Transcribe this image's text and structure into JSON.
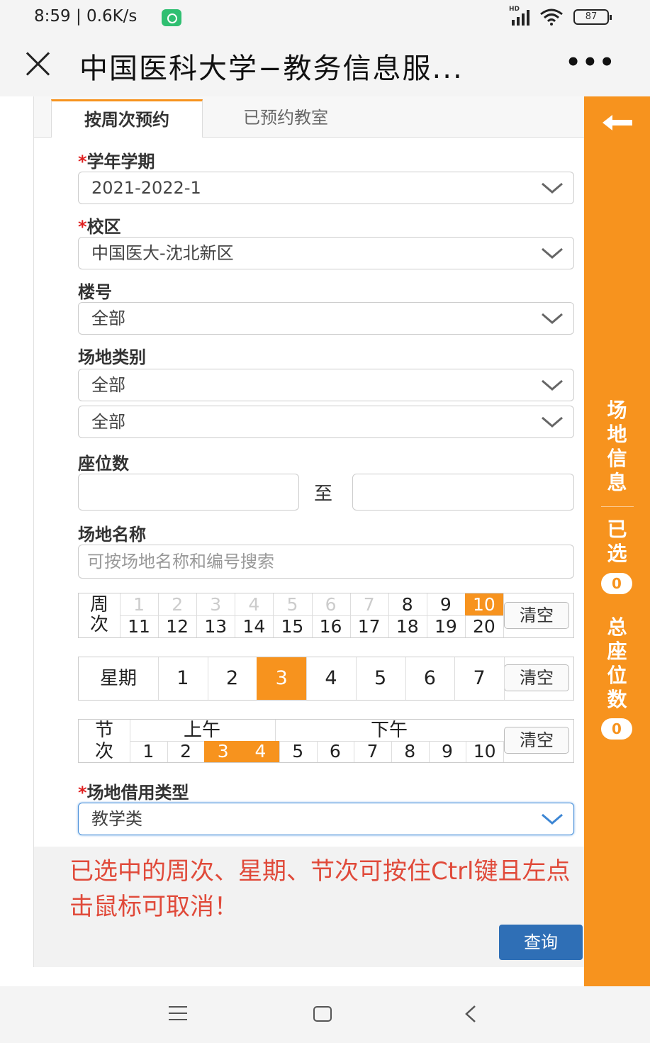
{
  "status_bar": {
    "time": "8:59 | 0.6K/s",
    "battery": "87",
    "signal_label": "HD"
  },
  "title_bar": {
    "title": "中国医科大学−教务信息服...",
    "more": "•••"
  },
  "tabs": [
    {
      "label": "按周次预约",
      "active": true
    },
    {
      "label": "已预约教室",
      "active": false
    }
  ],
  "form": {
    "term": {
      "label": "学年学期",
      "required": true,
      "value": "2021-2022-1"
    },
    "campus": {
      "label": "校区",
      "required": true,
      "value": "中国医大-沈北新区"
    },
    "building": {
      "label": "楼号",
      "value": "全部"
    },
    "venue_type": {
      "label": "场地类别",
      "value1": "全部",
      "value2": "全部"
    },
    "seats": {
      "label": "座位数",
      "to": "至",
      "from_value": "",
      "to_value": ""
    },
    "venue_name": {
      "label": "场地名称",
      "placeholder": "可按场地名称和编号搜索"
    },
    "borrow_type": {
      "label": "场地借用类型",
      "required": true,
      "value": "教学类"
    },
    "required_mark": "*"
  },
  "weeks": {
    "label_top": "周",
    "label_bottom": "次",
    "row1": [
      "1",
      "2",
      "3",
      "4",
      "5",
      "6",
      "7",
      "8",
      "9",
      "10"
    ],
    "row2": [
      "11",
      "12",
      "13",
      "14",
      "15",
      "16",
      "17",
      "18",
      "19",
      "20"
    ],
    "disabled": [
      "1",
      "2",
      "3",
      "4",
      "5",
      "6",
      "7"
    ],
    "selected": [
      "10"
    ],
    "clear": "清空"
  },
  "weekdays": {
    "label": "星期",
    "days": [
      "1",
      "2",
      "3",
      "4",
      "5",
      "6",
      "7"
    ],
    "selected": [
      "3"
    ],
    "clear": "清空"
  },
  "periods": {
    "label_top": "节",
    "label_bottom": "次",
    "morning": "上午",
    "afternoon": "下午",
    "items": [
      "1",
      "2",
      "3",
      "4",
      "5",
      "6",
      "7",
      "8",
      "9",
      "10"
    ],
    "selected": [
      "3",
      "4"
    ],
    "clear": "清空"
  },
  "notice": "已选中的周次、星期、节次可按住Ctrl键且左点击鼠标可取消！",
  "query_button": "查询",
  "sidebar": {
    "venue_info": "场地信息",
    "selected_label": "已选",
    "selected_count": "0",
    "total_seats_label": "总座位数",
    "total_seats_count": "0"
  },
  "colors": {
    "accent": "#f7931e",
    "primary": "#2f6fb6",
    "notice": "#e04a3a"
  }
}
